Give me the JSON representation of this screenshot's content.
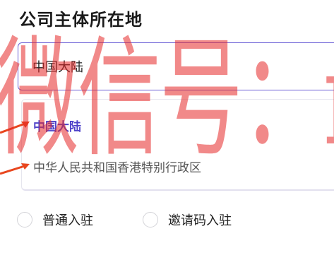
{
  "form": {
    "title": "公司主体所在地",
    "region_select": {
      "selected_value": "中国大陆",
      "options": [
        {
          "label": "中国大陆",
          "selected": true
        },
        {
          "label": "中华人民共和国香港特别行政区",
          "selected": false
        }
      ]
    },
    "entry_type": {
      "options": [
        {
          "label": "普通入驻",
          "checked": false
        },
        {
          "label": "邀请码入驻",
          "checked": false
        }
      ]
    }
  },
  "watermark": {
    "text": "微信号：muhuanidc"
  },
  "colors": {
    "accent": "#4f43c9",
    "select_border": "#6b5fd6",
    "annotation_arrow": "#e8461e",
    "watermark": "#e62828"
  }
}
